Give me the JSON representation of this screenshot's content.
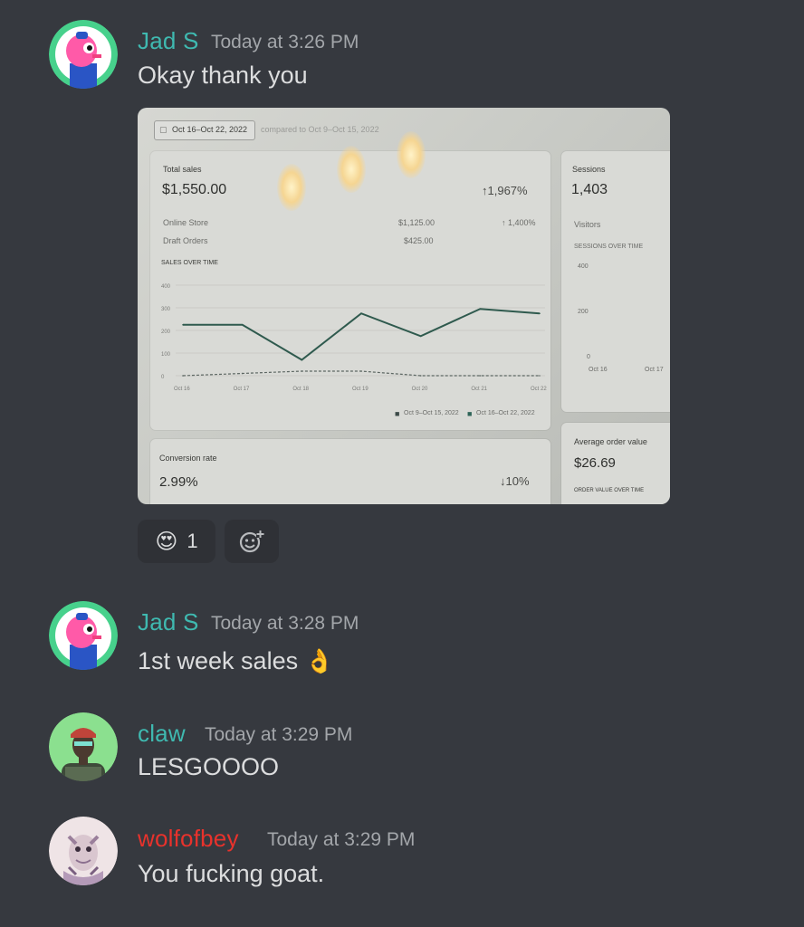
{
  "messages": [
    {
      "author": "Jad S",
      "author_color": "#3fb9b0",
      "time": "Today at 3:26 PM",
      "text": "Okay thank you",
      "avatar": "pink-character-avatar"
    },
    {
      "author": "Jad S",
      "author_color": "#3fb9b0",
      "time": "Today at 3:28 PM",
      "text": "1st week sales",
      "avatar": "pink-character-avatar"
    },
    {
      "author": "claw",
      "author_color": "#3fb9b0",
      "time": "Today at 3:29 PM",
      "text": "LESGOOOO",
      "avatar": "person-avatar"
    },
    {
      "author": "wolfofbey",
      "author_color": "#e8322c",
      "time": "Today at 3:29 PM",
      "text": "You fucking goat.",
      "avatar": "cartoon-avatar"
    }
  ],
  "reactions": [
    {
      "emoji": "😍",
      "count": "1"
    }
  ],
  "add_reaction_icon": "add-reaction-icon",
  "ok_hand_emoji": "👌",
  "photo": {
    "date_range": "Oct 16–Oct 22, 2022",
    "compared_to": "compared to Oct 9–Oct 15, 2022",
    "total_sales_label": "Total sales",
    "total_sales": "$1,550.00",
    "total_sales_change": "↑1,967%",
    "online_store_label": "Online Store",
    "online_store_value": "$1,125.00",
    "online_store_change": "↑ 1,400%",
    "draft_orders_label": "Draft Orders",
    "draft_orders_value": "$425.00",
    "sales_over_time_label": "SALES OVER TIME",
    "y_ticks": [
      "400",
      "300",
      "200",
      "100",
      "0"
    ],
    "x_ticks": [
      "Oct 16",
      "Oct 17",
      "Oct 18",
      "Oct 19",
      "Oct 20",
      "Oct 21",
      "Oct 22"
    ],
    "legend_prev": "Oct 9–Oct 15, 2022",
    "legend_curr": "Oct 16–Oct 22, 2022",
    "sessions_label": "Sessions",
    "sessions_value": "1,403",
    "visitors_label": "Visitors",
    "sessions_over_time": "SESSIONS OVER TIME",
    "sessions_y_ticks": [
      "400",
      "200",
      "0"
    ],
    "sessions_x_ticks": [
      "Oct 16",
      "Oct 17"
    ],
    "conversion_label": "Conversion rate",
    "conversion_value": "2.99%",
    "conversion_change": "↓10%",
    "aov_label": "Average order value",
    "aov_value": "$26.69",
    "aov_over_time": "ORDER VALUE OVER TIME"
  },
  "chart_data": {
    "type": "line",
    "categories": [
      "Oct 16",
      "Oct 17",
      "Oct 18",
      "Oct 19",
      "Oct 20",
      "Oct 21",
      "Oct 22"
    ],
    "series": [
      {
        "name": "Oct 16–Oct 22, 2022",
        "values": [
          225,
          225,
          70,
          275,
          175,
          295,
          275
        ]
      },
      {
        "name": "Oct 9–Oct 15, 2022",
        "values": [
          0,
          10,
          20,
          20,
          0,
          0,
          0
        ]
      }
    ],
    "ylim": [
      0,
      400
    ]
  }
}
